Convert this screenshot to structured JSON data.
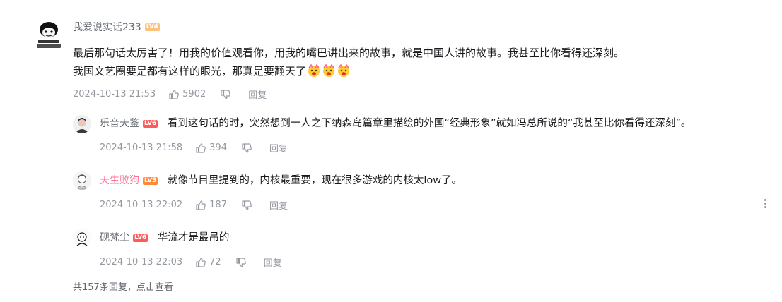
{
  "main_comment": {
    "username": "我爱说实话233",
    "level": "LV4",
    "level_color": "#ffc07a",
    "text_line1": "最后那句话太厉害了！用我的价值观看你，用我的嘴巴讲出来的故事，就是中国人讲的故事。我甚至比你看得还深刻。",
    "text_line2": "我国文艺圈要是都有这样的眼光，那真是要翻天了",
    "emoji_icon": "cheering-face-emoji",
    "time": "2024-10-13 21:53",
    "likes": "5902",
    "reply_label": "回复"
  },
  "replies": [
    {
      "username": "乐音天鉴",
      "level": "LV6",
      "level_color": "#ff5a5a",
      "text": "看到这句话的时，突然想到一人之下纳森岛篇章里描绘的外国“经典形象”就如冯总所说的“我甚至比你看得还深刻”。",
      "time": "2024-10-13 21:58",
      "likes": "394",
      "reply_label": "回复",
      "name_color": "#61666d"
    },
    {
      "username": "天生败狗",
      "level": "LV5",
      "level_color": "#ff8a3d",
      "text": "就像节目里提到的，内核最重要，现在很多游戏的内核太low了。",
      "time": "2024-10-13 22:02",
      "likes": "187",
      "reply_label": "回复",
      "name_color": "#fb7299"
    },
    {
      "username": "砚梵尘",
      "level": "LV6",
      "level_color": "#ff5a5a",
      "text": "华流才是最吊的",
      "time": "2024-10-13 22:03",
      "likes": "72",
      "reply_label": "回复",
      "name_color": "#61666d"
    }
  ],
  "view_more": {
    "count_text": "共157条回复，",
    "action_text": "点击查看"
  },
  "colors": {
    "text_primary": "#18191c",
    "text_secondary": "#61666d",
    "text_meta": "#9499a0",
    "vip_pink": "#fb7299"
  }
}
